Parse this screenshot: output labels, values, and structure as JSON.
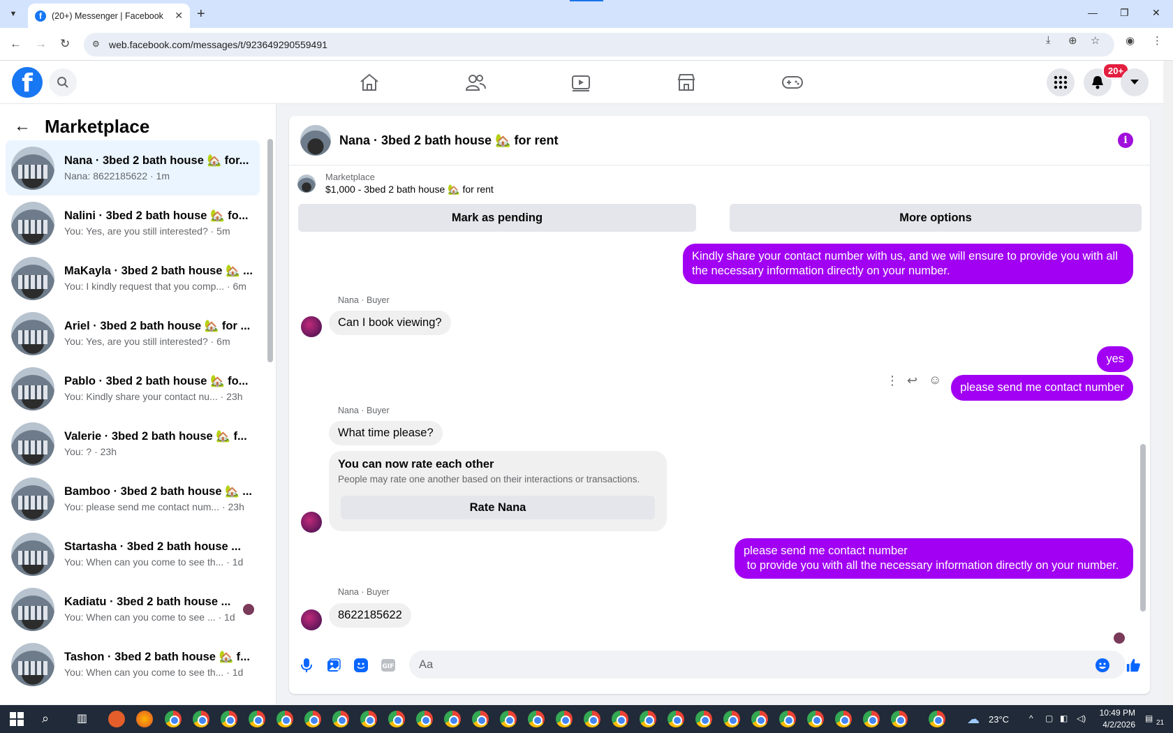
{
  "browser": {
    "tab_title": "(20+) Messenger | Facebook",
    "url": "web.facebook.com/messages/t/923649290559491"
  },
  "header": {
    "notif_badge": "20+"
  },
  "left": {
    "title": "Marketplace",
    "conversations": [
      {
        "name": "Nana · 3bed 2 bath house 🏡 for...",
        "snippet": "Nana: 8622185622 · 1m",
        "active": true
      },
      {
        "name": "Nalini · 3bed 2 bath house 🏡 fo...",
        "snippet": "You: Yes, are you still interested? · 5m"
      },
      {
        "name": "MaKayla · 3bed 2 bath house 🏡 ...",
        "snippet": "You: I kindly request that you comp... · 6m"
      },
      {
        "name": "Ariel · 3bed 2 bath house 🏡 for ...",
        "snippet": "You: Yes, are you still interested? · 6m"
      },
      {
        "name": "Pablo · 3bed 2 bath house 🏡 fo...",
        "snippet": "You: Kindly share your contact nu... · 23h"
      },
      {
        "name": "Valerie · 3bed 2 bath house 🏡 f...",
        "snippet": "You: ? · 23h"
      },
      {
        "name": "Bamboo · 3bed 2 bath house 🏡 ...",
        "snippet": "You: please send me contact num... · 23h"
      },
      {
        "name": "Startasha · 3bed 2 bath house ...",
        "snippet": "You: When can you come to see th... · 1d"
      },
      {
        "name": "Kadiatu · 3bed 2 bath house ...",
        "snippet": "You: When can you come to see ... · 1d"
      },
      {
        "name": "Tashon · 3bed 2 bath house 🏡 f...",
        "snippet": "You: When can you come to see th... · 1d"
      }
    ]
  },
  "chat": {
    "title": "Nana · 3bed 2 bath house 🏡 for rent",
    "listing_label": "Marketplace",
    "listing_text": "$1,000 - 3bed 2 bath house 🏡 for rent",
    "btn_pending": "Mark as pending",
    "btn_more": "More options",
    "msg1": "Kindly share your contact number with us, and we will ensure to provide you with all the necessary information directly on your number.",
    "sender": "Nana · Buyer",
    "msg2": "Can I book viewing?",
    "msg3": "yes",
    "msg4": "please send me contact number",
    "msg5": "What time please?",
    "rate_title": "You can now rate each other",
    "rate_sub": "People may rate one another based on their interactions or transactions.",
    "rate_btn": "Rate Nana",
    "msg6a": "please send me contact number",
    "msg6b": " to provide you with all the necessary information directly on your number.",
    "msg7": "8622185622",
    "composer_placeholder": "Aa"
  },
  "taskbar": {
    "temp": "23°C",
    "time": "10:49 PM",
    "date": "4/2/2026",
    "notif": "21"
  }
}
